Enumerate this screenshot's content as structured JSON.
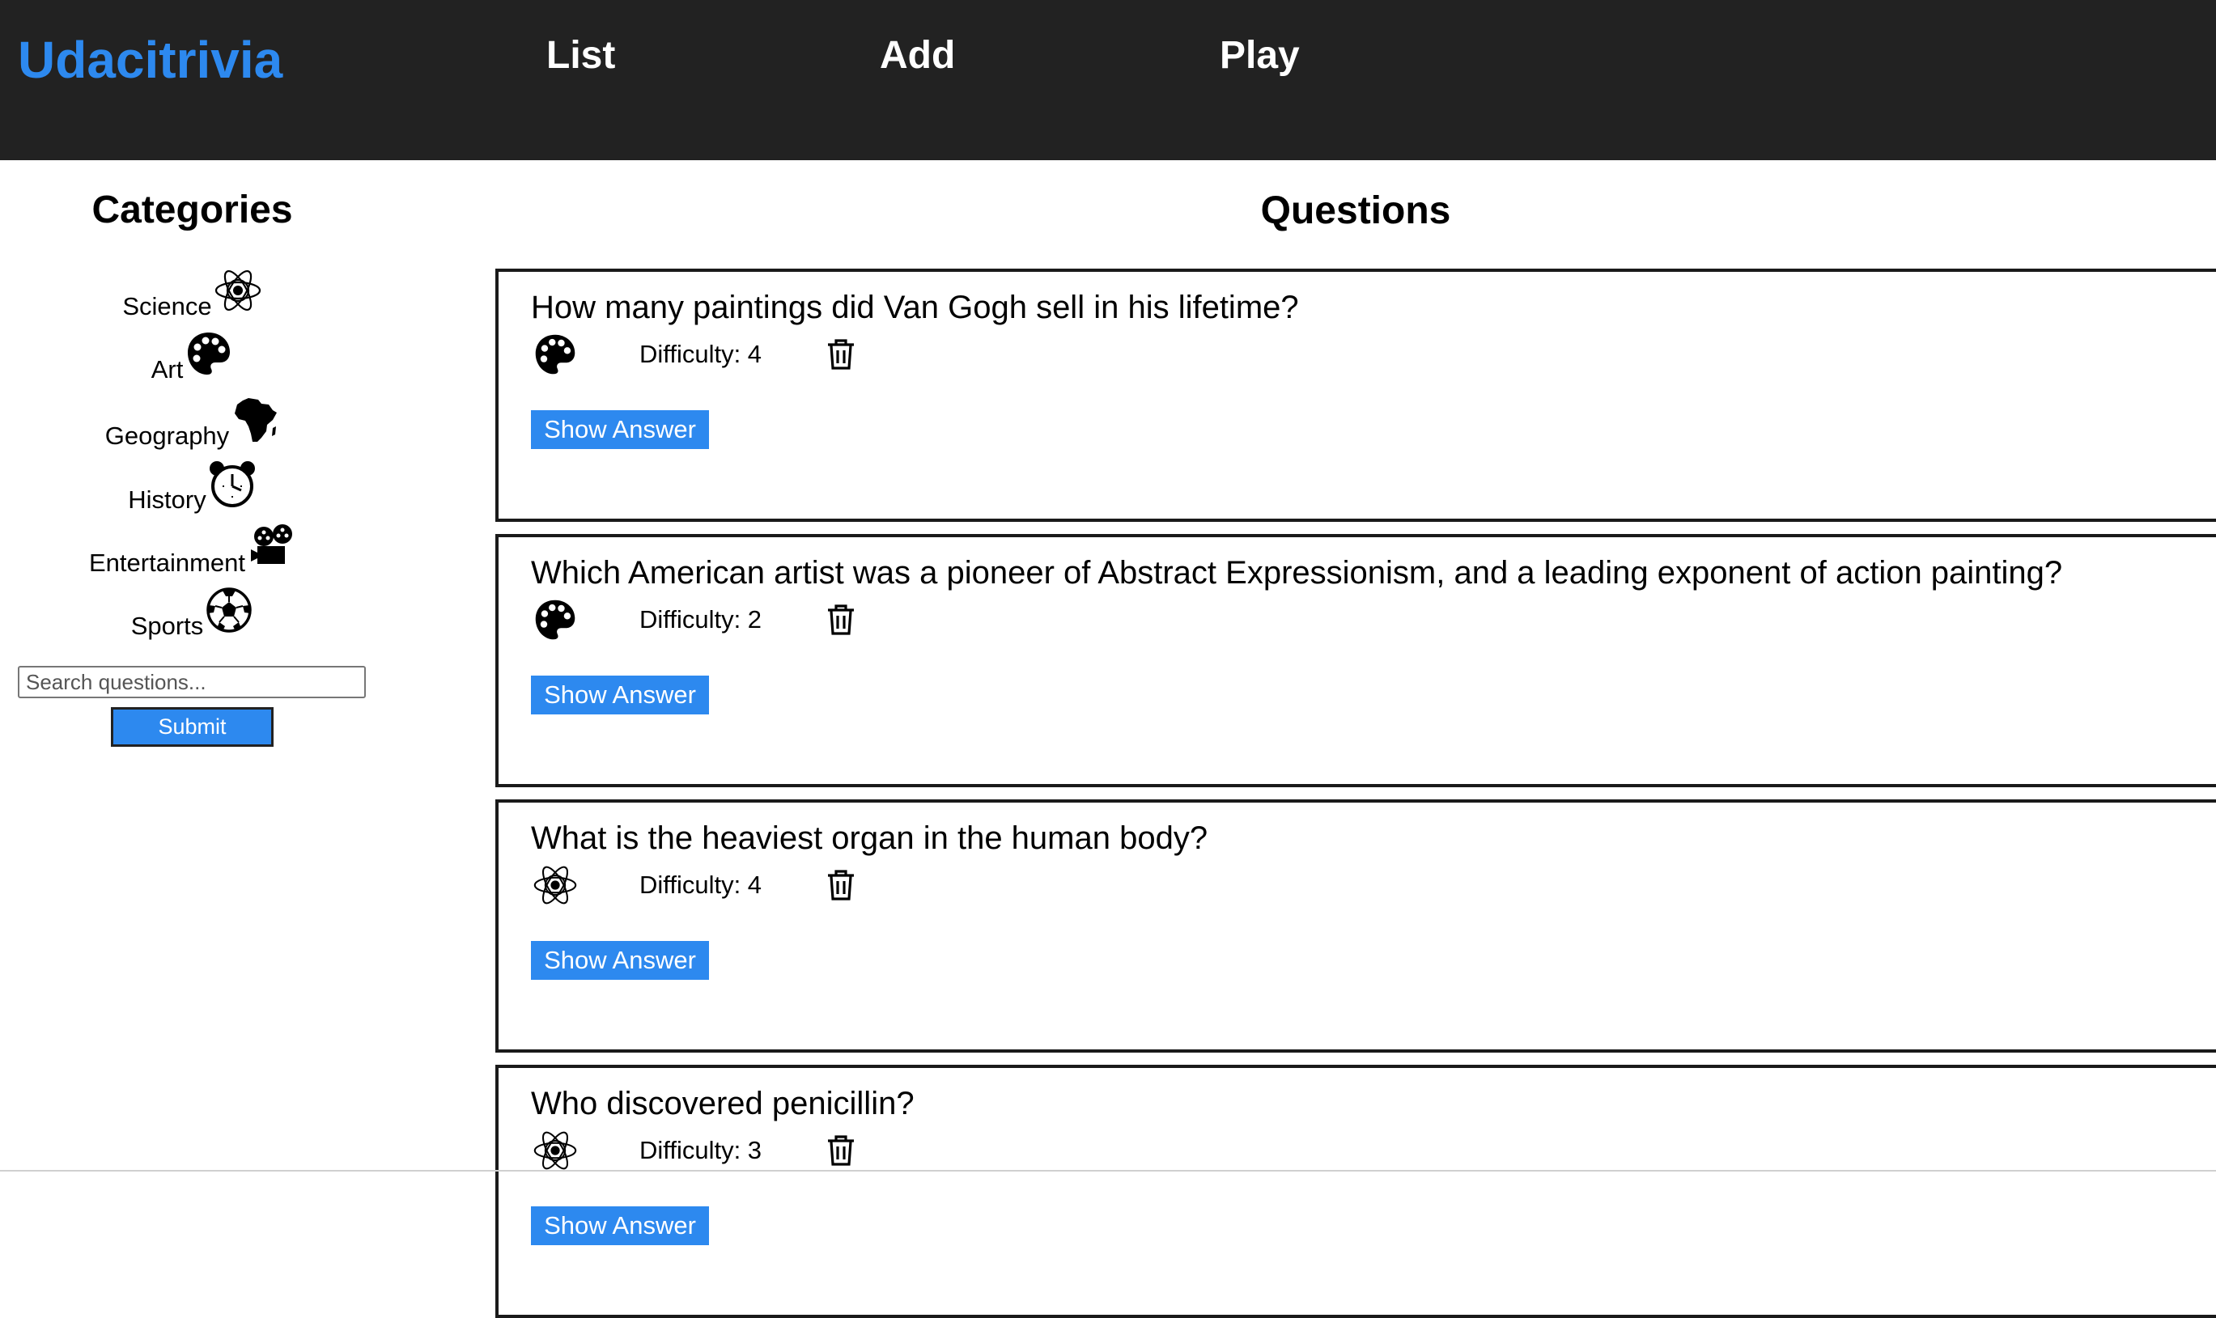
{
  "app": {
    "brand": "Udacitrivia"
  },
  "nav": {
    "list": "List",
    "add": "Add",
    "play": "Play"
  },
  "sidebar": {
    "title": "Categories",
    "categories": [
      {
        "label": "Science",
        "icon": "atom-icon"
      },
      {
        "label": "Art",
        "icon": "palette-icon"
      },
      {
        "label": "Geography",
        "icon": "africa-icon"
      },
      {
        "label": "History",
        "icon": "alarm-clock-icon"
      },
      {
        "label": "Entertainment",
        "icon": "film-projector-icon"
      },
      {
        "label": "Sports",
        "icon": "soccer-ball-icon"
      }
    ],
    "search_placeholder": "Search questions...",
    "submit_label": "Submit"
  },
  "main": {
    "title": "Questions",
    "questions": [
      {
        "text": "How many paintings did Van Gogh sell in his lifetime?",
        "category_icon": "palette-icon",
        "difficulty": "Difficulty: 4",
        "show_answer": "Show Answer"
      },
      {
        "text": "Which American artist was a pioneer of Abstract Expressionism, and a leading exponent of action painting?",
        "category_icon": "palette-icon",
        "difficulty": "Difficulty: 2",
        "show_answer": "Show Answer"
      },
      {
        "text": "What is the heaviest organ in the human body?",
        "category_icon": "atom-icon",
        "difficulty": "Difficulty: 4",
        "show_answer": "Show Answer"
      },
      {
        "text": "Who discovered penicillin?",
        "category_icon": "atom-icon",
        "difficulty": "Difficulty: 3",
        "show_answer": "Show Answer"
      }
    ]
  },
  "colors": {
    "brand": "#2d89ef",
    "navbar": "#222222",
    "button": "#2d89ef"
  }
}
